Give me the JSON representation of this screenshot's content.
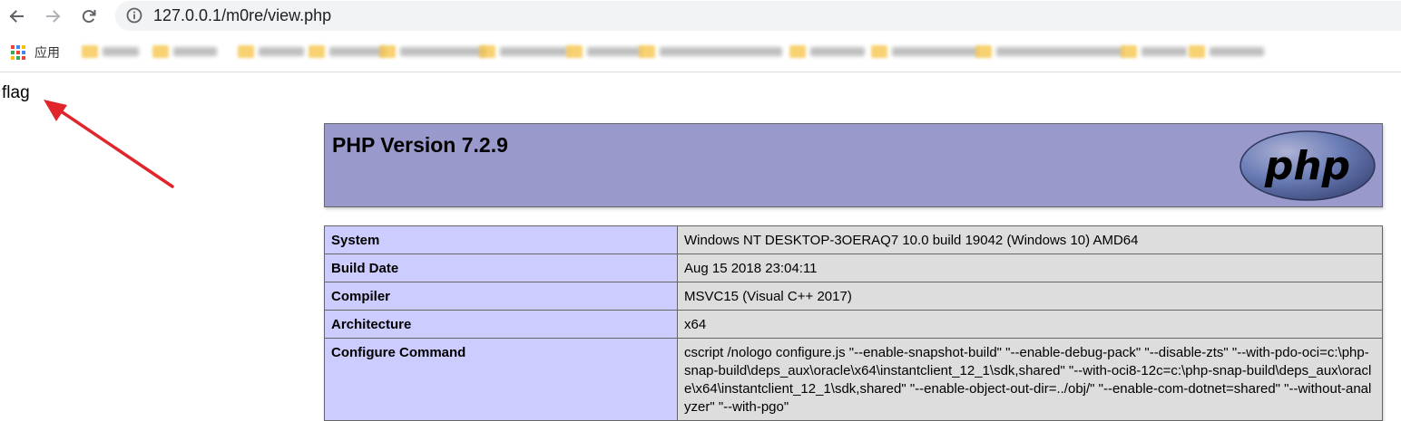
{
  "browser": {
    "url": "127.0.0.1/m0re/view.php",
    "icons": {
      "back": "arrow-left-icon",
      "forward": "arrow-right-icon",
      "reload": "reload-icon",
      "site_info": "info-circle-icon"
    },
    "bookmarks_bar": {
      "apps_label": "应用"
    }
  },
  "page": {
    "flag_text": "flag",
    "php_title": "PHP Version 7.2.9",
    "logo_text": "php",
    "rows": [
      {
        "key": "System",
        "value": "Windows NT DESKTOP-3OERAQ7 10.0 build 19042 (Windows 10) AMD64"
      },
      {
        "key": "Build Date",
        "value": "Aug 15 2018 23:04:11"
      },
      {
        "key": "Compiler",
        "value": "MSVC15 (Visual C++ 2017)"
      },
      {
        "key": "Architecture",
        "value": "x64"
      },
      {
        "key": "Configure Command",
        "value": "cscript /nologo configure.js \"--enable-snapshot-build\" \"--enable-debug-pack\" \"--disable-zts\" \"--with-pdo-oci=c:\\php-snap-build\\deps_aux\\oracle\\x64\\instantclient_12_1\\sdk,shared\" \"--with-oci8-12c=c:\\php-snap-build\\deps_aux\\oracle\\x64\\instantclient_12_1\\sdk,shared\" \"--enable-object-out-dir=../obj/\" \"--enable-com-dotnet=shared\" \"--without-analyzer\" \"--with-pgo\""
      }
    ]
  },
  "colors": {
    "php_header_bg": "#9999cc",
    "row_key_bg": "#ccccff",
    "row_value_bg": "#dddddd",
    "annotation_arrow": "#e0262b"
  }
}
